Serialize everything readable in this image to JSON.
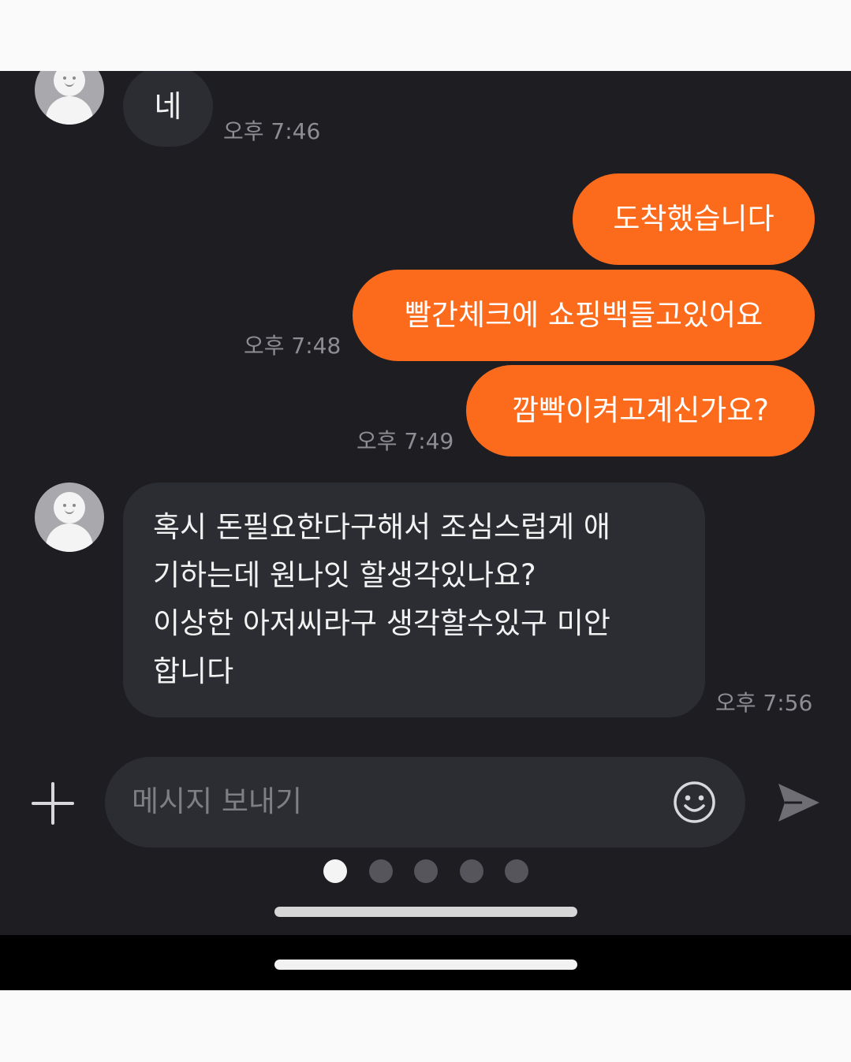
{
  "messages": [
    {
      "direction": "in",
      "text": "네",
      "time": "오후 7:46"
    },
    {
      "direction": "out",
      "text": "도착했습니다",
      "time": ""
    },
    {
      "direction": "out",
      "text": "빨간체크에 쇼핑백들고있어요",
      "time": "오후 7:48"
    },
    {
      "direction": "out",
      "text": "깜빡이켜고계신가요?",
      "time": "오후 7:49"
    },
    {
      "direction": "in",
      "lines": [
        "혹시 돈필요한다구해서 조심스럽게 애",
        "기하는데 원나잇 할생각있나요?",
        "이상한 아저씨라구 생각할수있구 미안",
        "합니다"
      ],
      "time": "오후 7:56"
    }
  ],
  "input": {
    "placeholder": "메시지 보내기"
  },
  "icons": {
    "avatar": "default-profile-icon",
    "plus": "plus-icon",
    "emoji": "smiley-icon",
    "send": "send-arrow-icon"
  },
  "pager": {
    "count": 5,
    "active_index": 0
  },
  "colors": {
    "background": "#1d1d22",
    "incoming_bubble": "#2b2d33",
    "outgoing_bubble": "#fc6b1c",
    "timestamp": "#8d8d93"
  }
}
